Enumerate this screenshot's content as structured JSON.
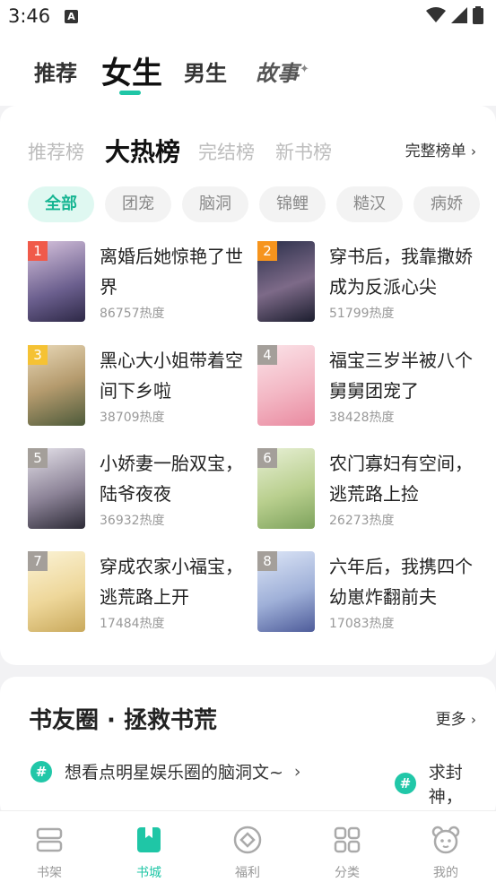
{
  "status": {
    "time": "3:46",
    "notif_letter": "A"
  },
  "topnav": {
    "tabs": [
      "推荐",
      "女生",
      "男生",
      "故事"
    ],
    "active": "女生"
  },
  "ranking": {
    "tabs": [
      "推荐榜",
      "大热榜",
      "完结榜",
      "新书榜"
    ],
    "active": "大热榜",
    "full_label": "完整榜单",
    "chips": [
      "全部",
      "团宠",
      "脑洞",
      "锦鲤",
      "糙汉",
      "病娇"
    ],
    "books": [
      {
        "rank": "1",
        "title": "离婚后她惊艳了世界",
        "heat": "86757热度",
        "rank_color": "#f05a4a"
      },
      {
        "rank": "2",
        "title": "穿书后，我靠撒娇成为反派心尖",
        "heat": "51799热度",
        "rank_color": "#f6941d"
      },
      {
        "rank": "3",
        "title": "黑心大小姐带着空间下乡啦",
        "heat": "38709热度",
        "rank_color": "#f5c234"
      },
      {
        "rank": "4",
        "title": "福宝三岁半被八个舅舅团宠了",
        "heat": "38428热度",
        "rank_color": "#a49f9a"
      },
      {
        "rank": "5",
        "title": "小娇妻一胎双宝，陆爷夜夜",
        "heat": "36932热度",
        "rank_color": "#a49f9a"
      },
      {
        "rank": "6",
        "title": "农门寡妇有空间，逃荒路上捡",
        "heat": "26273热度",
        "rank_color": "#a49f9a"
      },
      {
        "rank": "7",
        "title": "穿成农家小福宝，逃荒路上开",
        "heat": "17484热度",
        "rank_color": "#a49f9a"
      },
      {
        "rank": "8",
        "title": "六年后，我携四个幼崽炸翻前夫",
        "heat": "17083热度",
        "rank_color": "#a49f9a"
      }
    ]
  },
  "circle": {
    "title": "书友圈 · 拯救书荒",
    "more_label": "更多",
    "topics": [
      "想看点明星娱乐圈的脑洞文~",
      "求封神，"
    ]
  },
  "tabbar": {
    "items": [
      "书架",
      "书城",
      "福利",
      "分类",
      "我的"
    ],
    "active": "书城"
  },
  "colors": {
    "accent": "#1fc6a6",
    "chip_active_bg": "#dff8f1"
  }
}
